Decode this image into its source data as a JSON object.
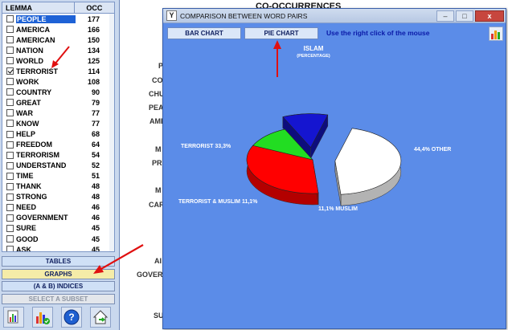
{
  "left_panel": {
    "header": {
      "lemma": "LEMMA",
      "occ": "OCC"
    },
    "rows": [
      {
        "word": "PEOPLE",
        "occ": "177",
        "checked": false,
        "selected": true
      },
      {
        "word": "AMERICA",
        "occ": "166",
        "checked": false,
        "selected": false
      },
      {
        "word": "AMERICAN",
        "occ": "150",
        "checked": false,
        "selected": false
      },
      {
        "word": "NATION",
        "occ": "134",
        "checked": false,
        "selected": false
      },
      {
        "word": "WORLD",
        "occ": "125",
        "checked": false,
        "selected": false
      },
      {
        "word": "TERRORIST",
        "occ": "114",
        "checked": true,
        "selected": false
      },
      {
        "word": "WORK",
        "occ": "108",
        "checked": false,
        "selected": false
      },
      {
        "word": "COUNTRY",
        "occ": "90",
        "checked": false,
        "selected": false
      },
      {
        "word": "GREAT",
        "occ": "79",
        "checked": false,
        "selected": false
      },
      {
        "word": "WAR",
        "occ": "77",
        "checked": false,
        "selected": false
      },
      {
        "word": "KNOW",
        "occ": "77",
        "checked": false,
        "selected": false
      },
      {
        "word": "HELP",
        "occ": "68",
        "checked": false,
        "selected": false
      },
      {
        "word": "FREEDOM",
        "occ": "64",
        "checked": false,
        "selected": false
      },
      {
        "word": "TERRORISM",
        "occ": "54",
        "checked": false,
        "selected": false
      },
      {
        "word": "UNDERSTAND",
        "occ": "52",
        "checked": false,
        "selected": false
      },
      {
        "word": "TIME",
        "occ": "51",
        "checked": false,
        "selected": false
      },
      {
        "word": "THANK",
        "occ": "48",
        "checked": false,
        "selected": false
      },
      {
        "word": "STRONG",
        "occ": "48",
        "checked": false,
        "selected": false
      },
      {
        "word": "NEED",
        "occ": "46",
        "checked": false,
        "selected": false
      },
      {
        "word": "GOVERNMENT",
        "occ": "46",
        "checked": false,
        "selected": false
      },
      {
        "word": "SURE",
        "occ": "45",
        "checked": false,
        "selected": false
      },
      {
        "word": "GOOD",
        "occ": "45",
        "checked": false,
        "selected": false
      },
      {
        "word": "ASK",
        "occ": "45",
        "checked": false,
        "selected": false
      }
    ],
    "buttons": {
      "tables": "TABLES",
      "graphs": "GRAPHS",
      "indices": "(A & B)  INDICES",
      "subset": "SELECT A SUBSET"
    },
    "toolbar_icons": [
      "chart-export-icon",
      "chart-settings-icon",
      "help-icon",
      "home-exit-icon"
    ]
  },
  "background": {
    "title": "CO-OCCURRENCES",
    "fragments": [
      "P",
      "CO",
      "CHU",
      "PEA",
      "AME",
      "M",
      "PR",
      "M",
      "CAR",
      "AI",
      "GOVER",
      "SU"
    ]
  },
  "dialog": {
    "title": "COMPARISON BETWEEN WORD PAIRS",
    "bar_chart_label": "BAR CHART",
    "pie_chart_label": "PIE CHART",
    "hint": "Use the right click of the mouse",
    "window_controls": {
      "minimize": "–",
      "maximize": "□",
      "close": "x"
    }
  },
  "chart_data": {
    "type": "pie",
    "title": "ISLAM",
    "subtitle": "(PERCENTAGE)",
    "slices": [
      {
        "label": "OTHER",
        "value": 44.4,
        "display": "44,4%  OTHER",
        "color": "#ffffff",
        "exploded": true
      },
      {
        "label": "TERRORIST",
        "value": 33.3,
        "display": "TERRORIST  33,3%",
        "color": "#ff0000",
        "exploded": false
      },
      {
        "label": "TERRORIST & MUSLIM",
        "value": 11.1,
        "display": "TERRORIST & MUSLIM  11,1%",
        "color": "#22dd22",
        "exploded": false
      },
      {
        "label": "MUSLIM",
        "value": 11.1,
        "display": "11,1%  MUSLIM",
        "color": "#1515d0",
        "exploded": true
      }
    ]
  },
  "colors": {
    "dialog_bg": "#5b8ce8",
    "selected_row": "#1e62d6",
    "graphs_button": "#f5eca8",
    "annotation_arrow": "#e01010"
  }
}
